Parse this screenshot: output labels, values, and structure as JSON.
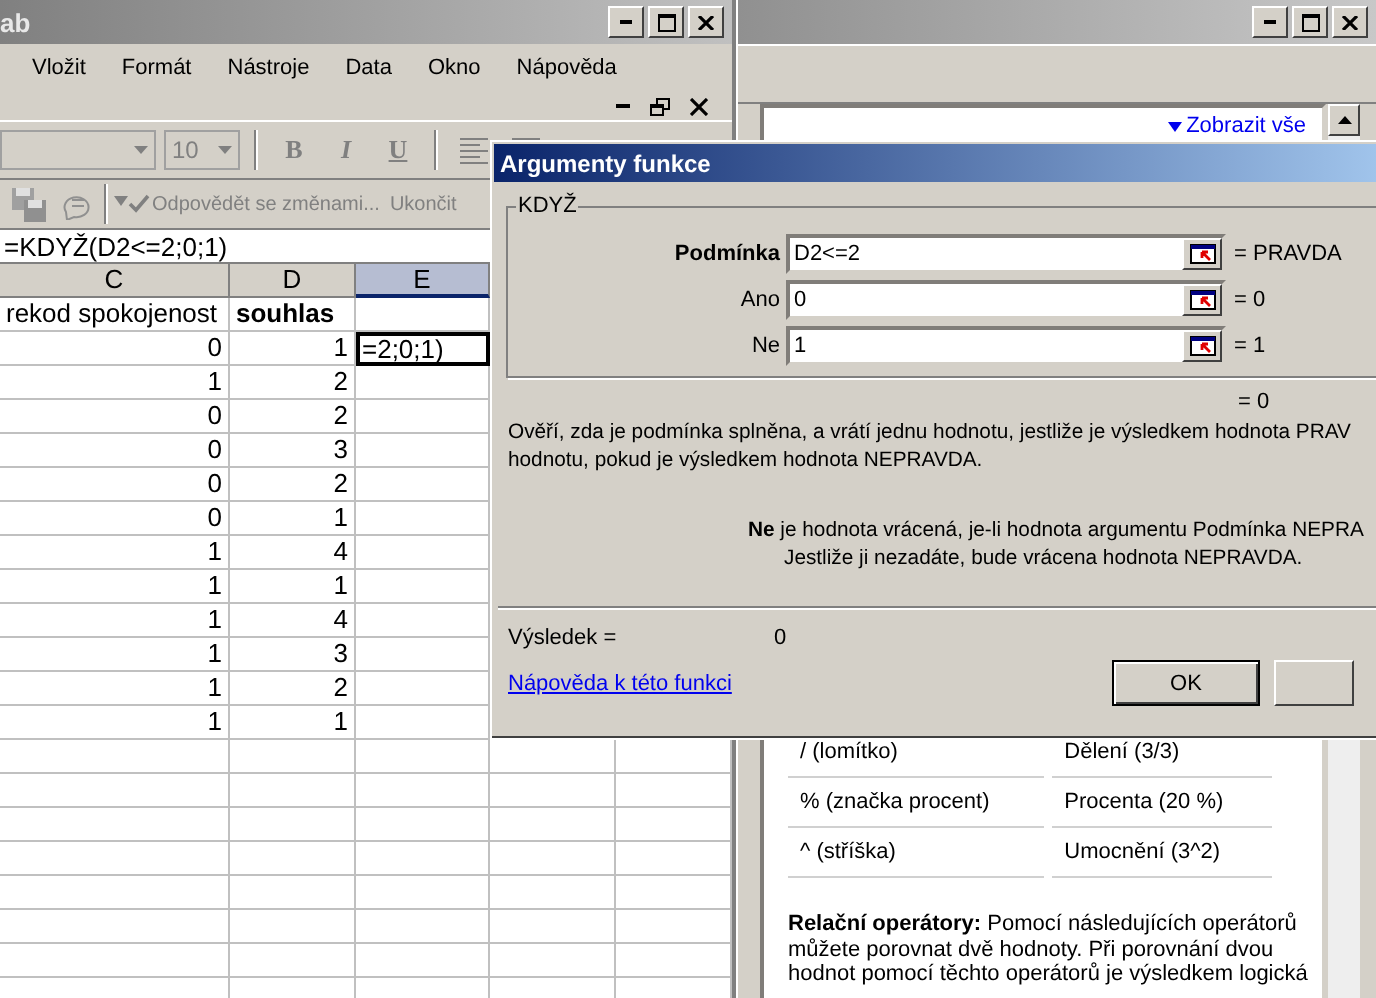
{
  "excel": {
    "title": "ab",
    "menu": [
      {
        "label": "Vložit"
      },
      {
        "label": "Formát"
      },
      {
        "label": "Nástroje"
      },
      {
        "label": "Data"
      },
      {
        "label": "Okno"
      },
      {
        "label": "Nápověda"
      }
    ],
    "toolbar": {
      "disabled": true,
      "font_size": "10",
      "format_buttons": [
        {
          "label": "B",
          "kind": "bold"
        },
        {
          "label": "I",
          "kind": "italic"
        },
        {
          "label": "U",
          "kind": "underline"
        }
      ],
      "review": "Odpovědět se změnami...",
      "end_review": "Ukončit"
    },
    "formula": "=KDYŽ(D2<=2;0;1)",
    "columns": [
      {
        "label": "C",
        "selected": false
      },
      {
        "label": "D",
        "selected": false
      },
      {
        "label": "E",
        "selected": true
      }
    ],
    "rows": [
      {
        "kind": "header",
        "cells": [
          {
            "text": "rekod spokojenost",
            "selected": false
          },
          {
            "text": "souhlas",
            "selected": false
          }
        ]
      },
      {
        "kind": "data",
        "cells": [
          {
            "text": "0",
            "selected": false
          },
          {
            "text": "1",
            "selected": false
          },
          {
            "text": "=2;0;1)",
            "selected": true
          }
        ]
      },
      {
        "kind": "data",
        "cells": [
          {
            "text": "1",
            "selected": false
          },
          {
            "text": "2",
            "selected": false
          }
        ]
      },
      {
        "kind": "data",
        "cells": [
          {
            "text": "0",
            "selected": false
          },
          {
            "text": "2",
            "selected": false
          }
        ]
      },
      {
        "kind": "data",
        "cells": [
          {
            "text": "0",
            "selected": false
          },
          {
            "text": "3",
            "selected": false
          }
        ]
      },
      {
        "kind": "data",
        "cells": [
          {
            "text": "0",
            "selected": false
          },
          {
            "text": "2",
            "selected": false
          }
        ]
      },
      {
        "kind": "data",
        "cells": [
          {
            "text": "0",
            "selected": false
          },
          {
            "text": "1",
            "selected": false
          }
        ]
      },
      {
        "kind": "data",
        "cells": [
          {
            "text": "1",
            "selected": false
          },
          {
            "text": "4",
            "selected": false
          }
        ]
      },
      {
        "kind": "data",
        "cells": [
          {
            "text": "1",
            "selected": false
          },
          {
            "text": "1",
            "selected": false
          }
        ]
      },
      {
        "kind": "data",
        "cells": [
          {
            "text": "1",
            "selected": false
          },
          {
            "text": "4",
            "selected": false
          }
        ]
      },
      {
        "kind": "data",
        "cells": [
          {
            "text": "1",
            "selected": false
          },
          {
            "text": "3",
            "selected": false
          }
        ]
      },
      {
        "kind": "data",
        "cells": [
          {
            "text": "1",
            "selected": false
          },
          {
            "text": "2",
            "selected": false
          }
        ]
      },
      {
        "kind": "data",
        "cells": [
          {
            "text": "1",
            "selected": false
          },
          {
            "text": "1",
            "selected": false
          }
        ]
      }
    ]
  },
  "help": {
    "show_all": "Zobrazit vše",
    "operators": [
      {
        "operator": "/ (lomítko)",
        "meaning": "Dělení (3/3)"
      },
      {
        "operator": "% (značka procent)",
        "meaning": "Procenta (20 %)"
      },
      {
        "operator": "^ (stříška)",
        "meaning": "Umocnění (3^2)"
      }
    ],
    "paragraph": [
      "**Relační operátory:** Pomocí následujících operátorů",
      "můžete porovnat dvě hodnoty. Při porovnání dvou",
      "hodnot pomocí těchto operátorů je výsledkem logická"
    ]
  },
  "dialog": {
    "title": "Argumenty funkce",
    "function": "KDYŽ",
    "arguments": [
      {
        "label": "Podmínka",
        "kind": "required",
        "value": "D2<=2",
        "result": "= PRAVDA"
      },
      {
        "label": "Ano",
        "kind": "optional",
        "value": "0",
        "result": "= 0"
      },
      {
        "label": "Ne",
        "kind": "optional",
        "value": "1",
        "result": "= 1"
      }
    ],
    "function_result": "= 0",
    "description": [
      "Ověří, zda je podmínka splněna, a vrátí jednu hodnotu, jestliže je výsledkem hodnota PRAV",
      "hodnotu, pokud je výsledkem hodnota NEPRAVDA."
    ],
    "argument_help": [
      "**Ne** je hodnota vrácená, je-li hodnota argumentu Podmínka NEPRA",
      "Jestliže ji nezadáte, bude vrácena hodnota NEPRAVDA."
    ],
    "result_label": "Výsledek =",
    "result_value": "0",
    "help_link": "Nápověda k této funkci",
    "ok": "OK"
  }
}
